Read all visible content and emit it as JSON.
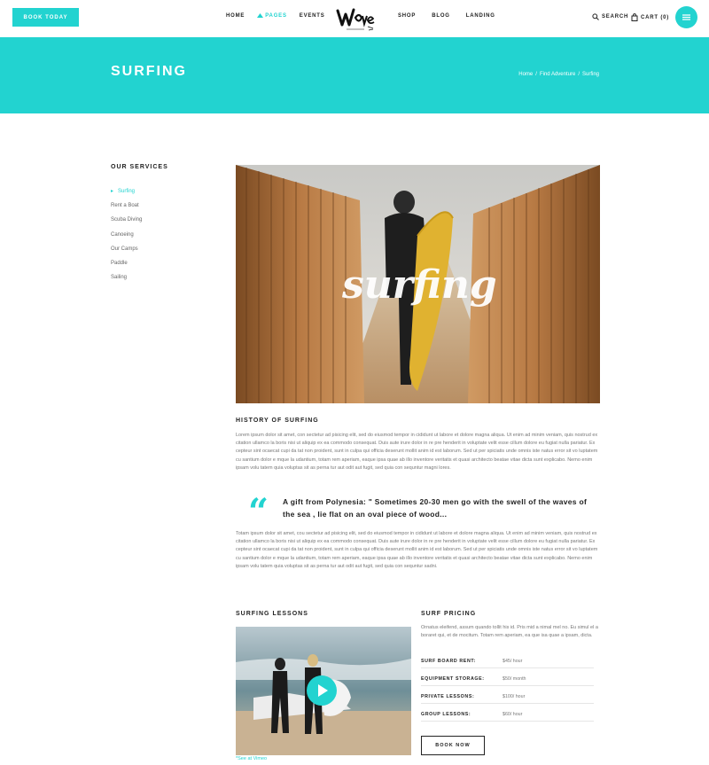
{
  "header": {
    "book_today": "BOOK TODAY",
    "nav_left": [
      "HOME",
      "PAGES",
      "EVENTS"
    ],
    "active_nav": "PAGES",
    "nav_right": [
      "SHOP",
      "BLOG",
      "LANDING"
    ],
    "logo_text": "Wave",
    "search": "SEARCH",
    "cart": "CART (0)"
  },
  "band": {
    "title": "SURFING",
    "breadcrumb": [
      "Home",
      "Find Adventure",
      "Surfing"
    ],
    "separator": "/"
  },
  "sidebar": {
    "title": "OUR SERVICES",
    "items": [
      "Surfing",
      "Rent a Boat",
      "Scuba Diving",
      "Canoeing",
      "Our Camps",
      "Paddle",
      "Sailing"
    ],
    "active": "Surfing"
  },
  "hero": {
    "overlay_text": "surfing"
  },
  "history": {
    "title": "HISTORY OF SURFING",
    "para1": "Lorem ipsum dolor sit amet, con sectetur ad pisicing elit, sed do eiusmod tempor in cididunt ut labore et dolore magna aliqua. Ut enim ad minim veniam, quis nostrud ex citation ullamco la boris nisi ut aliquip ex ea commodo consequat. Duis aute irure dolor in re pre henderit in voluptate velit esse cillum dolore eu fugiat nulla pariatur. Ex cepteur sint ocaecat cupi da tat non proident, sunt in culpa qui officia deserunt mollit anim id est laborum. Sed ut per spiciatis unde omnis iste natus error sit vo luptatem cu santium dolor e mque la udantium, totam rem aperiam, eaque ipsa quae ab illo inventore veritatis et quasi architecto beatae vitae dicta sunt explicabo. Nemo enim ipsam volu tatem quia voluptas sit as perna tur aut odit aut fugit, sed quia con sequntur magni lores.",
    "quote": "A gift from Polynesia: \" Sometimes 20-30 men go with the swell of the waves of the sea , lie flat on an oval piece of wood...",
    "para2": "Totam ipsum dolor sit amet, cou sectetur ad pisicing elit, sed do eiusmod tempor in cididunt ut labore et dolore magna aliqua. Ut enim ad minim veniam, quis nostrud ex citation ullamco la boris nisi ut aliquip ex ea commodo consequat. Duis aute irure dolor in re pre henderit in voluptate velit esse cillum dolore eu fugiat nulla pariatur. Ex cepteur sint ocaecat cupi da tat non proident, sunt in culpa qui officia deserunt mollit anim id est laborum. Sed ut per spiciatis unde omnis iste natus error sit vo luptatem cu santium dolor e mque la udantium, totam rem aperiam, eaque ipsa quae ab illo inventore veritatis et quasi architecto beatae vitae dicta sunt explicabo. Nemo enim ipsam volu tatem quia voluptas sit as perna tur aut odit aut fugit, sed quia con sequntur sadni."
  },
  "lessons": {
    "title": "SURFING LESSONS",
    "video_link": "*See at Vimeo"
  },
  "pricing": {
    "title": "SURF PRICING",
    "intro": "Ornatus eleifend, assum quando tollit his id. Pris mid a nimal mel no. Eu simul el a boraret qui, et de mocitum. Totam rem aperiam, ea que isa quae a ipsam, dicta.",
    "rows": [
      {
        "label": "SURF BOARD RENT:",
        "value": "$45/ hour"
      },
      {
        "label": "EQUIPMENT STORAGE:",
        "value": "$50/ month"
      },
      {
        "label": "PRIVATE LESSONS:",
        "value": "$100/ hour"
      },
      {
        "label": "GROUP LESSONS:",
        "value": "$60/ hour"
      }
    ],
    "book_now": "BOOK NOW"
  },
  "colors": {
    "accent": "#22d3d0"
  }
}
